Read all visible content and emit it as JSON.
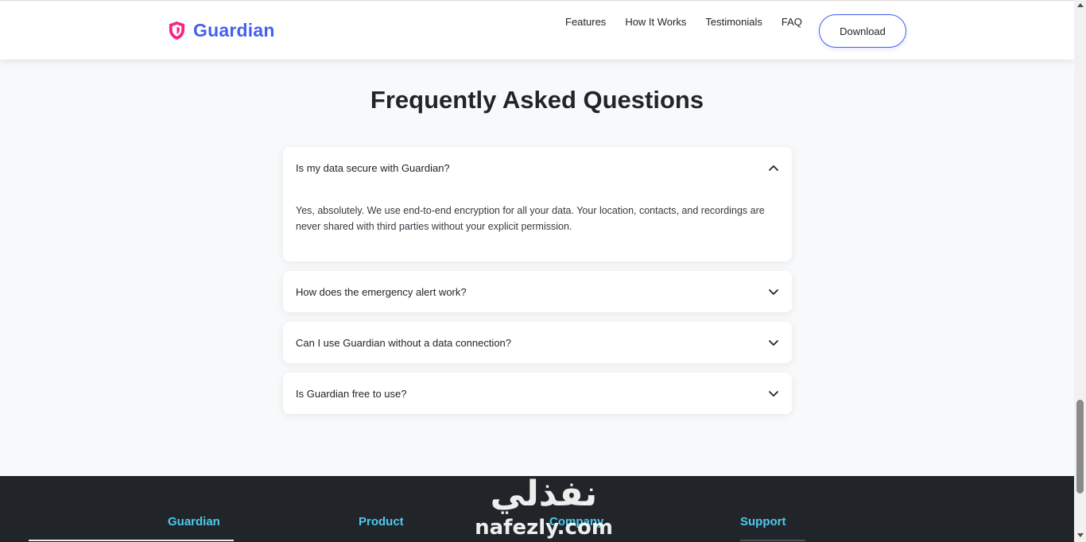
{
  "nav": {
    "brand": "Guardian",
    "links": [
      "Features",
      "How It Works",
      "Testimonials",
      "FAQ"
    ],
    "download_label": "Download",
    "brand_icon": "shield-icon",
    "brand_color": "#4361ee",
    "shield_color": "#f72585"
  },
  "faq": {
    "title": "Frequently Asked Questions",
    "items": [
      {
        "question": "Is my data secure with Guardian?",
        "answer": "Yes, absolutely. We use end-to-end encryption for all your data. Your location, contacts, and recordings are never shared with third parties without your explicit permission.",
        "expanded": true,
        "icon": "chevron-up-icon"
      },
      {
        "question": "How does the emergency alert work?",
        "expanded": false,
        "icon": "chevron-down-icon"
      },
      {
        "question": "Can I use Guardian without a data connection?",
        "expanded": false,
        "icon": "chevron-down-icon"
      },
      {
        "question": "Is Guardian free to use?",
        "expanded": false,
        "icon": "chevron-down-icon"
      }
    ]
  },
  "footer": {
    "headings": [
      "Guardian",
      "Product",
      "Company",
      "Support"
    ],
    "heading_color": "#4cc9f0",
    "background": "#212529"
  },
  "watermark": {
    "arabic_text": "نفذلي",
    "latin_text": "nafezly.com"
  }
}
